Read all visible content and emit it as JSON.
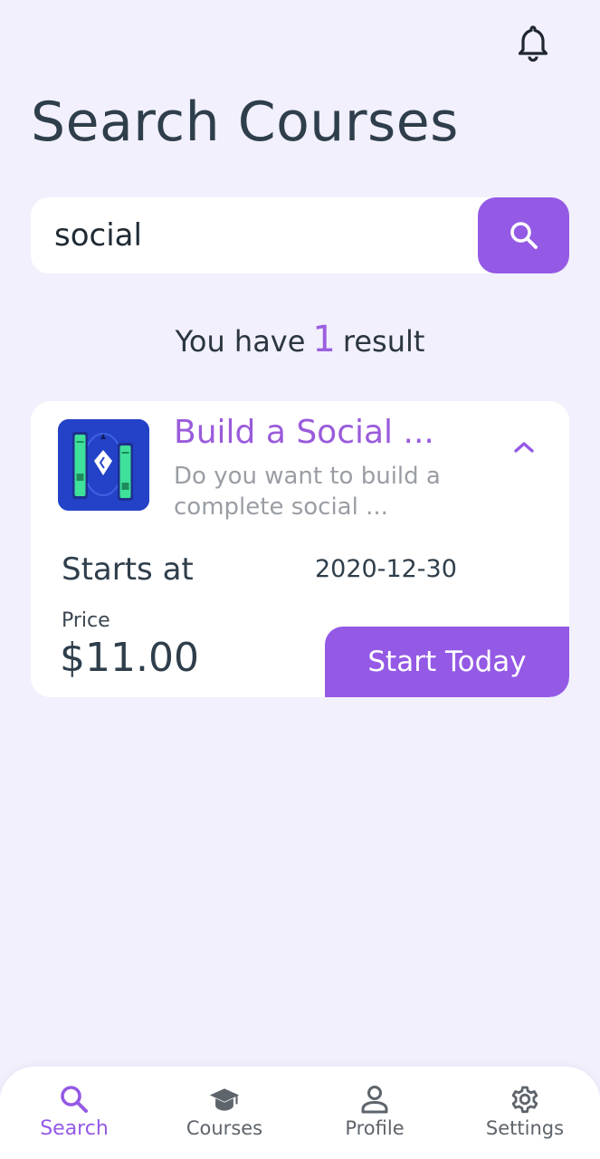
{
  "header": {
    "notification_icon": "bell-icon",
    "title": "Search Courses"
  },
  "search": {
    "value": "social",
    "button_icon": "search-icon"
  },
  "results": {
    "prefix": "You have",
    "count": "1",
    "suffix": "result"
  },
  "course": {
    "title": "Build a Social ...",
    "description": "Do you want to build a complete social ...",
    "starts_label": "Starts at",
    "start_date": "2020-12-30",
    "price_label": "Price",
    "price": "$11.00",
    "cta_label": "Start Today",
    "toggle_icon": "chevron-up-icon"
  },
  "nav": {
    "items": [
      {
        "label": "Search",
        "icon": "search-icon",
        "active": true
      },
      {
        "label": "Courses",
        "icon": "graduation-cap-icon",
        "active": false
      },
      {
        "label": "Profile",
        "icon": "user-icon",
        "active": false
      },
      {
        "label": "Settings",
        "icon": "gear-icon",
        "active": false
      }
    ]
  },
  "colors": {
    "background": "#f1f0fc",
    "accent": "#9459e5",
    "text": "#2f3e4b",
    "muted": "#9a9ea4"
  }
}
